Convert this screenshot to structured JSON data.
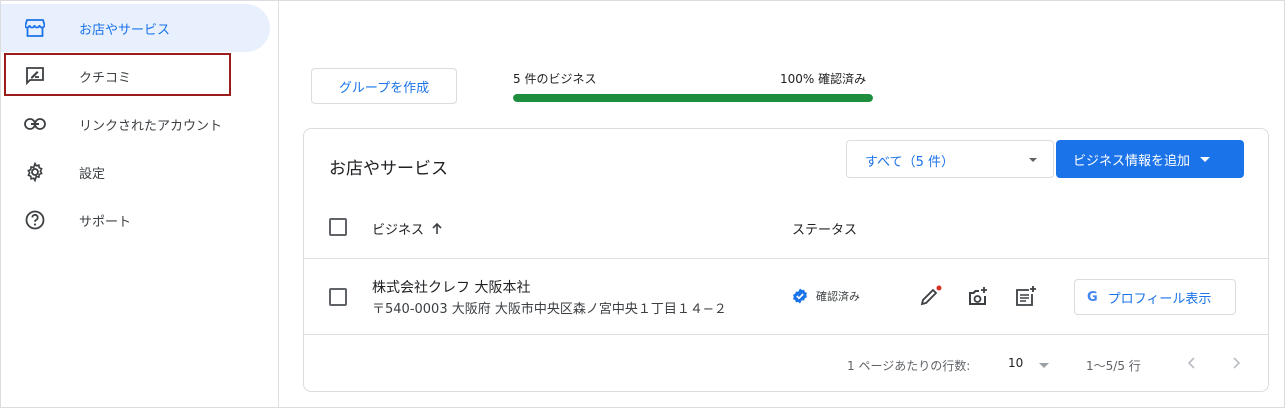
{
  "sidebar": {
    "items": [
      {
        "label": "お店やサービス",
        "icon": "storefront-icon",
        "active": true
      },
      {
        "label": "クチコミ",
        "icon": "rate-review-icon",
        "active": false
      },
      {
        "label": "リンクされたアカウント",
        "icon": "link-icon",
        "active": false
      },
      {
        "label": "設定",
        "icon": "gear-icon",
        "active": false
      },
      {
        "label": "サポート",
        "icon": "help-circle-icon",
        "active": false
      }
    ]
  },
  "top": {
    "group_button": "グループを作成",
    "progress_left": "5 件のビジネス",
    "progress_right": "100% 確認済み",
    "progress_fraction": 1.0
  },
  "card": {
    "title": "お店やサービス",
    "filter_value": "すべて（5 件）",
    "add_button": "ビジネス情報を追加",
    "columns": {
      "business": "ビジネス",
      "status": "ステータス"
    },
    "rows": [
      {
        "name": "株式会社クレフ 大阪本社",
        "address": "〒540-0003 大阪府 大阪市中央区森ノ宮中央１丁目１４−２",
        "status": "確認済み",
        "profile_button": "プロフィール表示"
      }
    ],
    "footer": {
      "rows_per_page_label": "1 ページあたりの行数:",
      "rows_per_page_value": "10",
      "range": "1〜5/5 行"
    }
  },
  "colors": {
    "accent": "#1a73e8",
    "progress": "#1e8e3e",
    "highlight_box": "#9b1c1c",
    "notification_dot": "#d93025"
  }
}
